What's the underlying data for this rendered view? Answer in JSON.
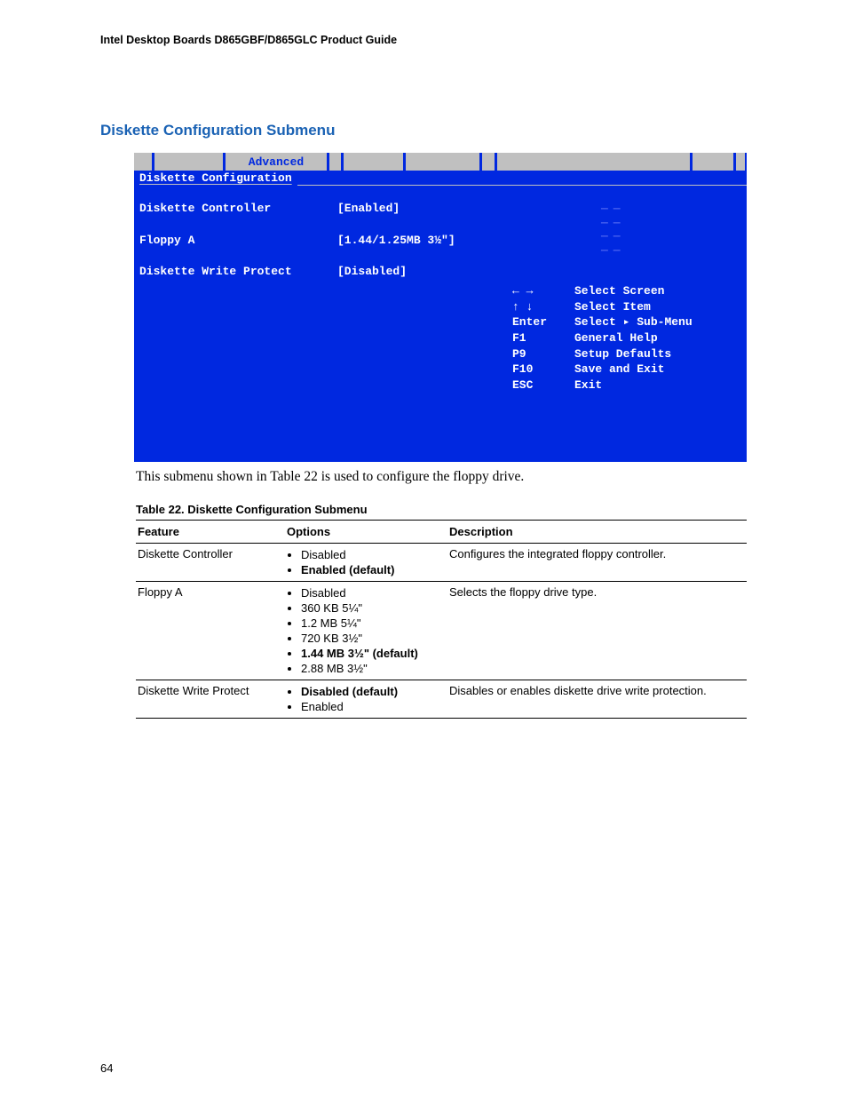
{
  "header": {
    "title": "Intel Desktop Boards D865GBF/D865GLC Product Guide"
  },
  "section": {
    "title": "Diskette Configuration Submenu"
  },
  "bios": {
    "tab_active": "Advanced",
    "subtitle": "Diskette Configuration",
    "fields": {
      "controller_label": "Diskette Controller",
      "controller_value": "[Enabled]",
      "floppy_label": "Floppy A",
      "floppy_value": "[1.44/1.25MB 3½\"]",
      "write_label": "Diskette Write Protect",
      "write_value": "[Disabled]"
    },
    "help": {
      "r1_key": "← →",
      "r1_txt": "Select Screen",
      "r2_key": "↑ ↓",
      "r2_txt": "Select Item",
      "r3_key": "Enter",
      "r3_txt": "Select ▸ Sub-Menu",
      "r4_key": "F1",
      "r4_txt": "General Help",
      "r5_key": "P9",
      "r5_txt": "Setup Defaults",
      "r6_key": "F10",
      "r6_txt": "Save and Exit",
      "r7_key": "ESC",
      "r7_txt": "Exit"
    }
  },
  "caption": {
    "text": "This submenu shown in Table 22 is used to configure the floppy drive."
  },
  "table": {
    "title": "Table 22.   Diskette Configuration Submenu",
    "headers": {
      "c1": "Feature",
      "c2": "Options",
      "c3": "Description"
    },
    "rows": [
      {
        "feature": "Diskette Controller",
        "options": [
          "Disabled",
          "Enabled (default)"
        ],
        "bold_idx": 1,
        "description": "Configures the integrated floppy controller."
      },
      {
        "feature": "Floppy A",
        "options": [
          "Disabled",
          "360 KB 5¼\"",
          "1.2 MB 5¼\"",
          "720 KB 3½\"",
          "1.44 MB 3½\" (default)",
          "2.88 MB 3½\""
        ],
        "bold_idx": 4,
        "description": "Selects the floppy drive type."
      },
      {
        "feature": "Diskette Write Protect",
        "options": [
          "Disabled (default)",
          "Enabled"
        ],
        "bold_idx": 0,
        "description": "Disables or enables diskette drive write protection."
      }
    ]
  },
  "footer": {
    "page": "64"
  }
}
